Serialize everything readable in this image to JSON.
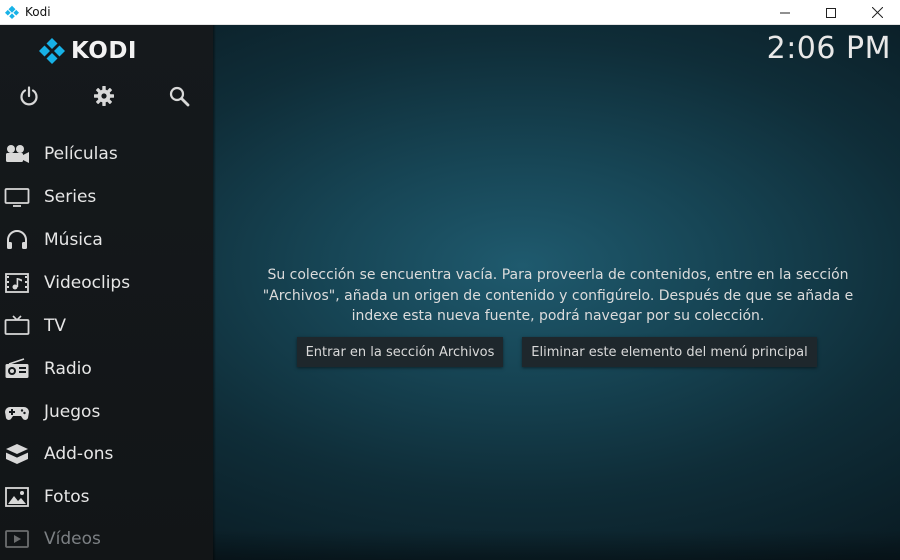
{
  "window": {
    "title": "Kodi",
    "controls": {
      "minimize": "—",
      "maximize": "☐",
      "close": "✕"
    }
  },
  "logo": {
    "text": "KODI",
    "icon": "kodi-logo-icon"
  },
  "top_icons": [
    {
      "name": "power-icon"
    },
    {
      "name": "gear-icon"
    },
    {
      "name": "search-icon"
    }
  ],
  "clock": "2:06 PM",
  "menu": [
    {
      "label": "Películas",
      "icon": "movies-icon"
    },
    {
      "label": "Series",
      "icon": "tv-series-icon"
    },
    {
      "label": "Música",
      "icon": "headphones-icon"
    },
    {
      "label": "Videoclips",
      "icon": "music-video-icon"
    },
    {
      "label": "TV",
      "icon": "tv-icon"
    },
    {
      "label": "Radio",
      "icon": "radio-icon"
    },
    {
      "label": "Juegos",
      "icon": "gamepad-icon"
    },
    {
      "label": "Add-ons",
      "icon": "addons-icon"
    },
    {
      "label": "Fotos",
      "icon": "photos-icon"
    },
    {
      "label": "Vídeos",
      "icon": "videos-icon"
    }
  ],
  "content": {
    "message_lines": [
      "Su colección se encuentra vacía. Para proveerla de contenidos, entre en la sección",
      "\"Archivos\", añada un origen de contenido y configúrelo. Después de que se añada e",
      "indexe esta nueva fuente, podrá navegar por su colección."
    ],
    "button_enter": "Entrar en la sección Archivos",
    "button_remove": "Eliminar este elemento del menú principal"
  },
  "colors": {
    "accent": "#17b2e7",
    "sidebar": "#14181b",
    "background": "#174656"
  }
}
